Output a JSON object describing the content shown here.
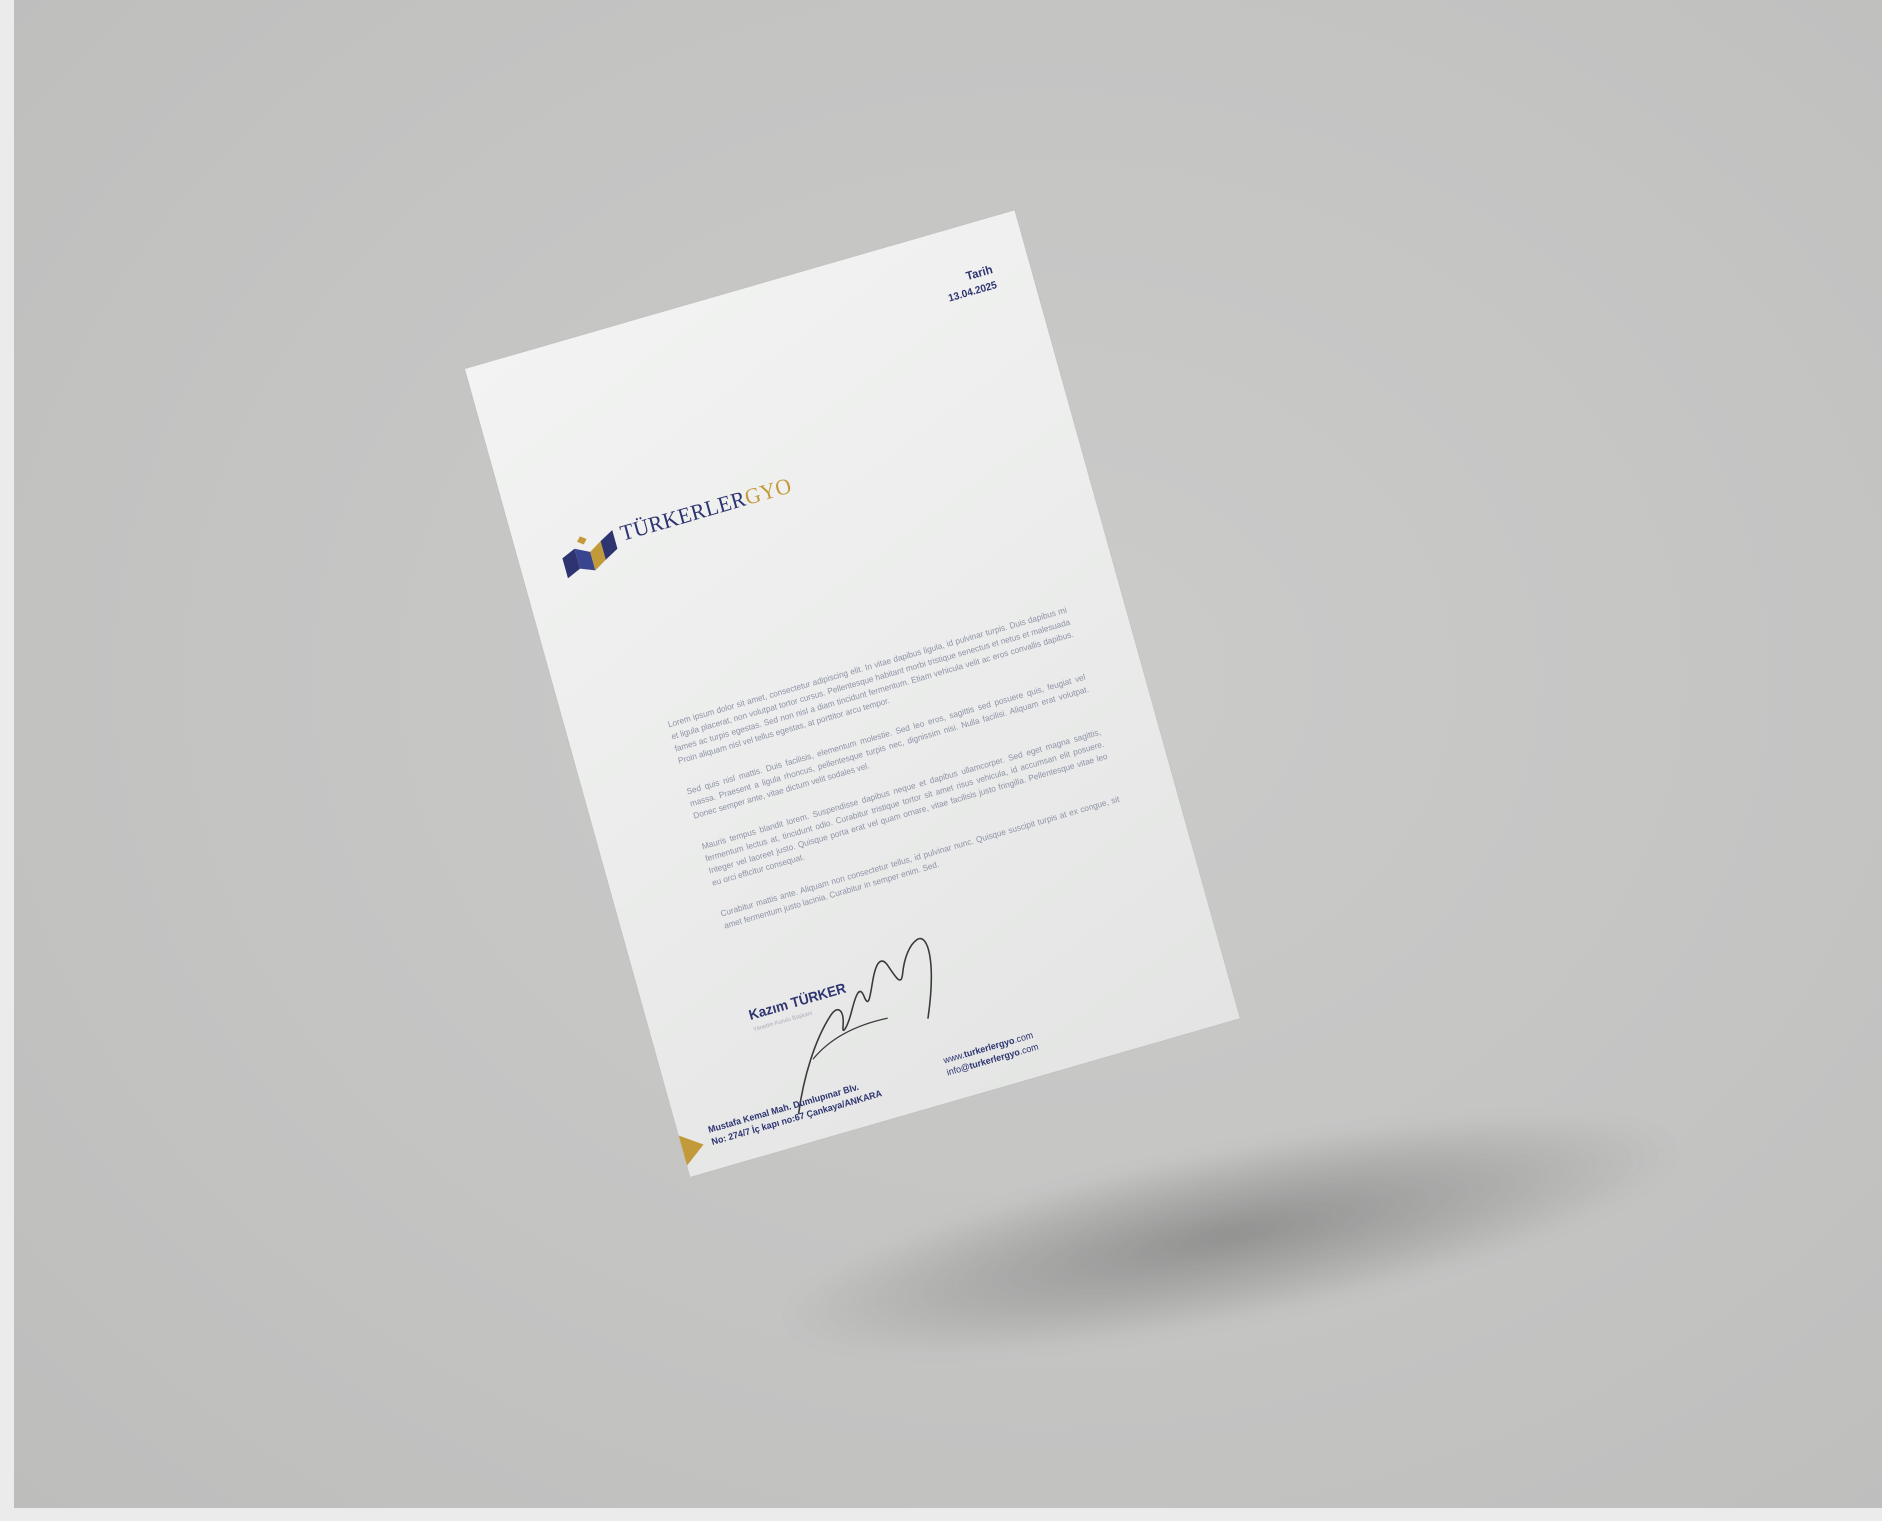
{
  "letterhead": {
    "company_name_main": "TÜRKERLER",
    "company_name_suffix": "GYO",
    "date_label": "Tarih",
    "date_value": "13.04.2025"
  },
  "body": {
    "paragraphs": [
      "Lorem ipsum dolor sit amet, consectetur adipiscing elit. In vitae dapibus ligula, id pulvinar turpis. Duis dapibus mi et ligula placerat, non volutpat tortor cursus. Pellentesque habitant morbi tristique senectus et netus et malesuada fames ac turpis egestas. Sed non nisl a diam tincidunt fermentum. Etiam vehicula velit ac eros convallis dapibus. Proin aliquam nisl vel tellus egestas, at porttitor arcu tempor.",
      "Sed quis nisl mattis. Duis facilisis, elementum molestie. Sed leo eros, sagittis sed posuere quis, feugiat vel massa. Praesent a ligula rhoncus, pellentesque turpis nec, dignissim nisi. Nulla facilisi. Aliquam erat volutpat. Donec semper ante, vitae dictum velit sodales vel.",
      "Mauris tempus blandit lorem. Suspendisse dapibus neque et dapibus ullamcorper. Sed eget magna sagittis, fermentum lectus at, tincidunt odio. Curabitur tristique tortor sit amet risus vehicula, id accumsan elit posuere. Integer vel laoreet justo. Quisque porta erat vel quam ornare, vitae facilisis justo fringilla. Pellentesque vitae leo eu orci efficitur consequat.",
      "Curabitur mattis ante. Aliquam non consectetur tellus, id pulvinar nunc. Quisque suscipit turpis at ex congue, sit amet fermentum justo lacinia. Curabitur in semper enim. Sed."
    ]
  },
  "signer": {
    "name": "Kazım TÜRKER",
    "title": "Yönetim Kurulu Başkanı"
  },
  "footer": {
    "address_line1": "Mustafa Kemal Mah. Dumlupınar Blv.",
    "address_line2": "No: 274/7 İç kapı no:67 Çankaya/ANKARA",
    "web_prefix": "www.",
    "web_domain": "turkerlergyo",
    "web_suffix": ".com",
    "email_prefix": "info@",
    "email_domain": "turkerlergyo",
    "email_suffix": ".com"
  },
  "colors": {
    "navy": "#2e3470",
    "gold": "#c39a3a",
    "background": "#c4c4c3",
    "paper": "#ecedec"
  }
}
